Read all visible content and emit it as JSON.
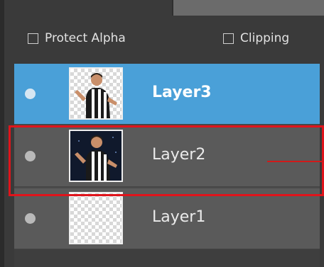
{
  "options": {
    "protect_alpha_label": "Protect Alpha",
    "clipping_label": "Clipping"
  },
  "layers": [
    {
      "name": "Layer3",
      "selected": true
    },
    {
      "name": "Layer2",
      "selected": false
    },
    {
      "name": "Layer1",
      "selected": false
    }
  ],
  "colors": {
    "selected_row": "#4aa0d8",
    "row": "#5a5a5a",
    "highlight_box": "#e0141b"
  }
}
